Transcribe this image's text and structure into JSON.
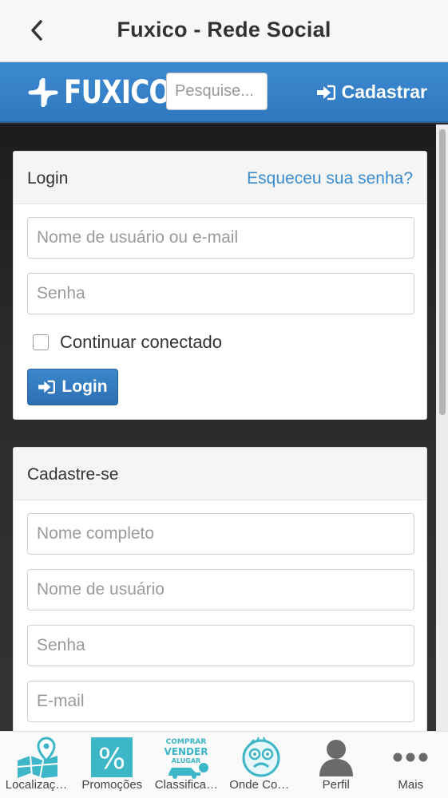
{
  "app_bar": {
    "title": "Fuxico - Rede Social",
    "back_icon": "chevron-left-icon"
  },
  "navbar": {
    "logo_text": "FUXICO",
    "search_placeholder": "Pesquise...",
    "signup_label": "Cadastrar",
    "signup_icon": "sign-in-icon"
  },
  "login_panel": {
    "title": "Login",
    "forgot_link": "Esqueceu sua senha?",
    "username_placeholder": "Nome de usuário ou e-mail",
    "password_placeholder": "Senha",
    "remember_label": "Continuar conectado",
    "button_label": "Login"
  },
  "signup_panel": {
    "title": "Cadastre-se",
    "fullname_placeholder": "Nome completo",
    "username_placeholder": "Nome de usuário",
    "password_placeholder": "Senha",
    "email_placeholder": "E-mail"
  },
  "tab_bar": {
    "items": [
      {
        "label": "Localizações",
        "icon": "map-pin-icon"
      },
      {
        "label": "Promoções",
        "icon": "percent-icon"
      },
      {
        "label": "Classificados",
        "icon": "classifieds-icon",
        "icon_text": [
          "COMPRAR",
          "VENDER",
          "ALUGAR"
        ]
      },
      {
        "label": "Onde Comer",
        "icon": "face-icon"
      },
      {
        "label": "Perfil",
        "icon": "user-icon"
      },
      {
        "label": "Mais",
        "icon": "more-dots-icon"
      }
    ]
  },
  "colors": {
    "brand_blue": "#3481c7",
    "link_blue": "#3a8ccf",
    "tab_teal": "#3db6c8"
  }
}
